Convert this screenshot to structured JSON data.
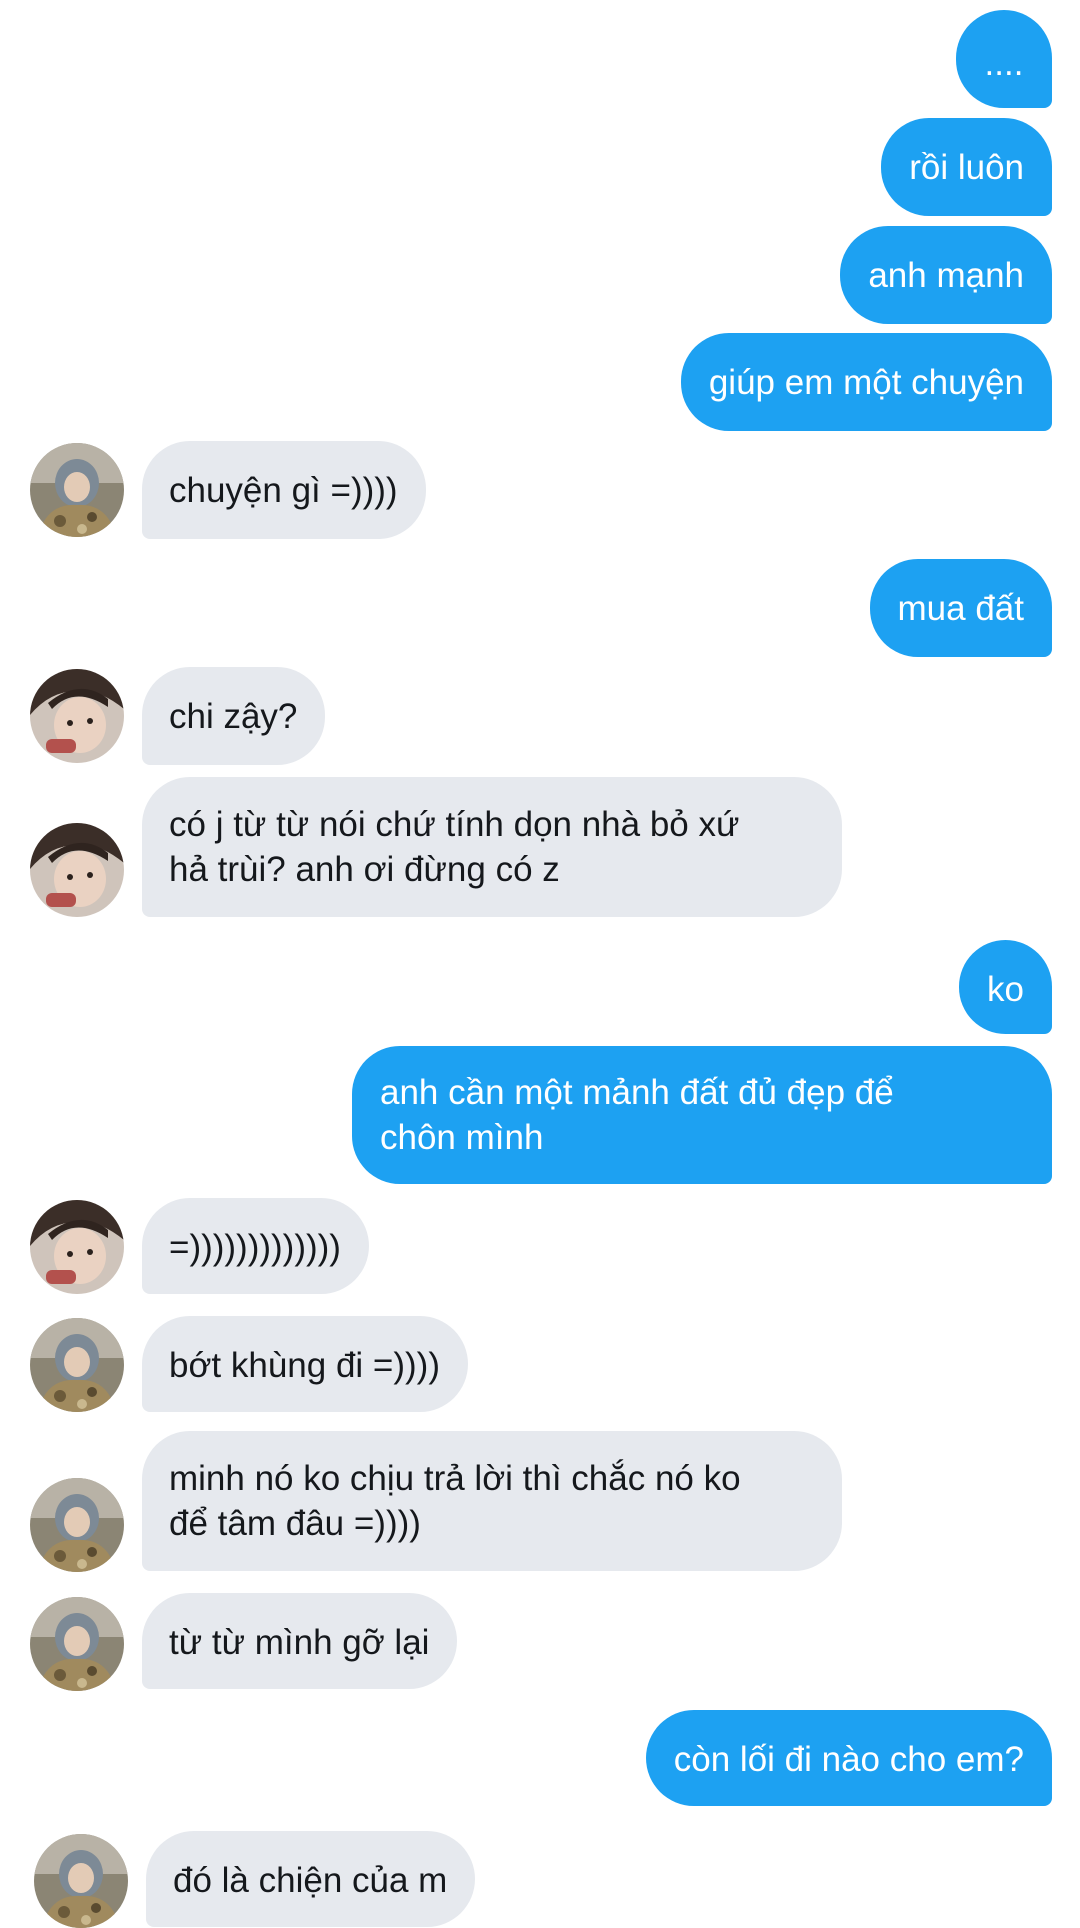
{
  "conversation": {
    "messages": [
      {
        "from": "me",
        "text": "...."
      },
      {
        "from": "me",
        "text": "rồi luôn"
      },
      {
        "from": "me",
        "text": "anh mạnh"
      },
      {
        "from": "me",
        "text": "giúp em một chuyện"
      },
      {
        "from": "other",
        "avatar": "avatar-hood-icon",
        "text": "chuyện gì =))))"
      },
      {
        "from": "me",
        "text": "mua đất"
      },
      {
        "from": "other",
        "avatar": "avatar-face-icon",
        "text": "chi zậy?"
      },
      {
        "from": "other",
        "avatar": "avatar-face-icon",
        "text": "có j từ từ nói chứ tính dọn nhà bỏ xứ\nhả trùi? anh ơi đừng có z"
      },
      {
        "from": "me",
        "text": "ko"
      },
      {
        "from": "me",
        "text": "anh cần một mảnh đất đủ đẹp để\nchôn mình"
      },
      {
        "from": "other",
        "avatar": "avatar-face-icon",
        "text": "=)))))))))))))"
      },
      {
        "from": "other",
        "avatar": "avatar-hood-icon",
        "text": "bớt khùng đi =))))"
      },
      {
        "from": "other",
        "avatar": "avatar-hood-icon",
        "text": "minh nó ko chịu trả lời thì chắc nó ko\nđể tâm đâu =))))"
      },
      {
        "from": "other",
        "avatar": "avatar-hood-icon",
        "text": "từ từ mình gỡ lại"
      },
      {
        "from": "me",
        "text": "còn lối đi nào cho em?"
      },
      {
        "from": "other",
        "avatar": "avatar-hood-icon",
        "text": "đó là chiện của m"
      }
    ]
  },
  "colors": {
    "outgoing_bubble": "#1DA1F2",
    "incoming_bubble": "#E6E9EE"
  }
}
